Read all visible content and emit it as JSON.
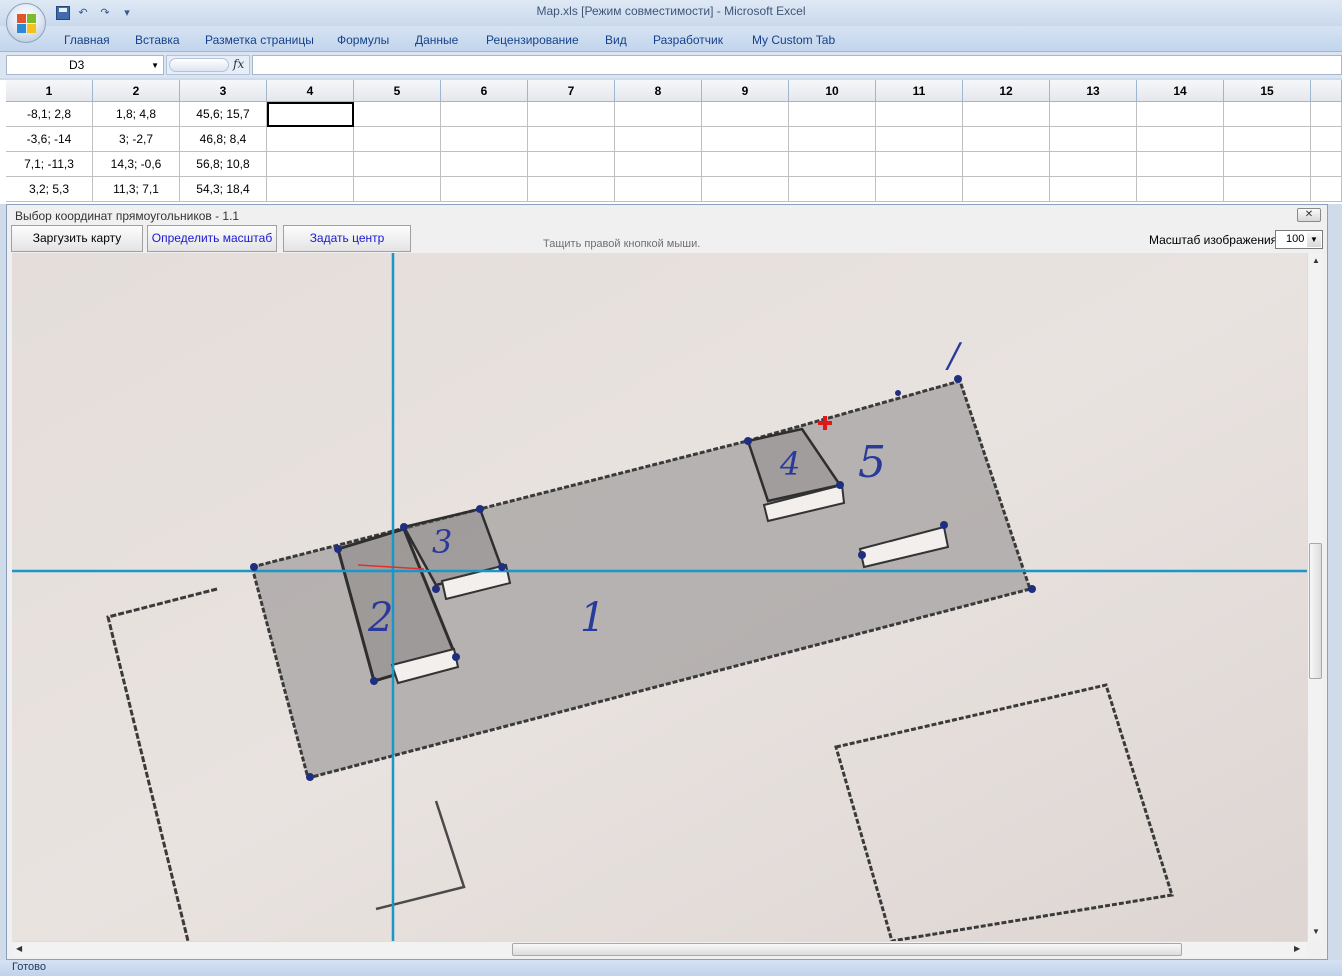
{
  "window": {
    "title": "Map.xls  [Режим совместимости] - Microsoft Excel"
  },
  "ribbon": {
    "tabs": [
      "Главная",
      "Вставка",
      "Разметка страницы",
      "Формулы",
      "Данные",
      "Рецензирование",
      "Вид",
      "Разработчик",
      "My Custom Tab"
    ]
  },
  "formula_bar": {
    "name_box": "D3",
    "fx_label": "fx",
    "formula": ""
  },
  "sheet": {
    "columns": [
      "1",
      "2",
      "3",
      "4",
      "5",
      "6",
      "7",
      "8",
      "9",
      "10",
      "11",
      "12",
      "13",
      "14",
      "15"
    ],
    "rows": [
      [
        "-8,1; 2,8",
        "1,8; 4,8",
        "45,6; 15,7"
      ],
      [
        "-3,6; -14",
        "3; -2,7",
        "46,8; 8,4"
      ],
      [
        "7,1; -11,3",
        "14,3; -0,6",
        "56,8; 10,8"
      ],
      [
        "3,2; 5,3",
        "11,3; 7,1",
        "54,3; 18,4"
      ]
    ]
  },
  "dialog": {
    "title": "Выбор координат прямоугольников - 1.1",
    "buttons": {
      "load_map": "Заргузить карту",
      "set_scale": "Определить масштаб",
      "set_center": "Задать центр"
    },
    "hint": "Тащить правой кнопкой мыши.",
    "scale_label": "Масштаб изображения:",
    "scale_value": "100",
    "sketch_labels": [
      "1",
      "2",
      "3",
      "4",
      "5",
      "/"
    ]
  },
  "status": {
    "ready": "Готово"
  }
}
